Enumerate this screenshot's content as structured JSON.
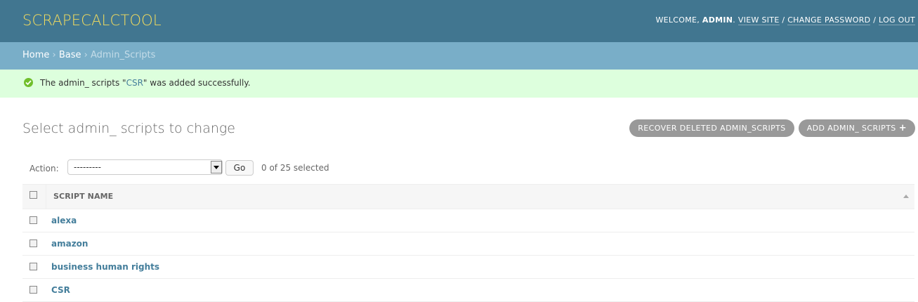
{
  "header": {
    "site_name": "SCRAPECALCTOOL",
    "welcome_prefix": "WELCOME, ",
    "username": "ADMIN",
    "view_site": "VIEW SITE",
    "change_password": "CHANGE PASSWORD",
    "log_out": "LOG OUT",
    "separator": " / "
  },
  "breadcrumbs": [
    {
      "label": "Home"
    },
    {
      "label": "Base"
    },
    {
      "label": "Admin_Scripts"
    }
  ],
  "message": {
    "prefix": "The admin_ scripts \"",
    "link": "CSR",
    "suffix": "\" was added successfully."
  },
  "page_title": "Select admin_ scripts to change",
  "object_tools": {
    "recover": "RECOVER DELETED ADMIN_SCRIPTS",
    "add": "ADD ADMIN_ SCRIPTS",
    "add_symbol": "+"
  },
  "actions": {
    "label": "Action:",
    "selected_value": "---------",
    "go_label": "Go",
    "counter": "0 of 25 selected"
  },
  "table": {
    "column_header": "SCRIPT NAME",
    "rows": [
      {
        "name": "alexa"
      },
      {
        "name": "amazon"
      },
      {
        "name": "business human rights"
      },
      {
        "name": "CSR"
      }
    ]
  },
  "colors": {
    "header_bg": "#417690",
    "breadcrumbs_bg": "#79aec8",
    "success_bg": "#ddffdd",
    "brand_yellow": "#f5dd5d",
    "link": "#447e9b"
  }
}
